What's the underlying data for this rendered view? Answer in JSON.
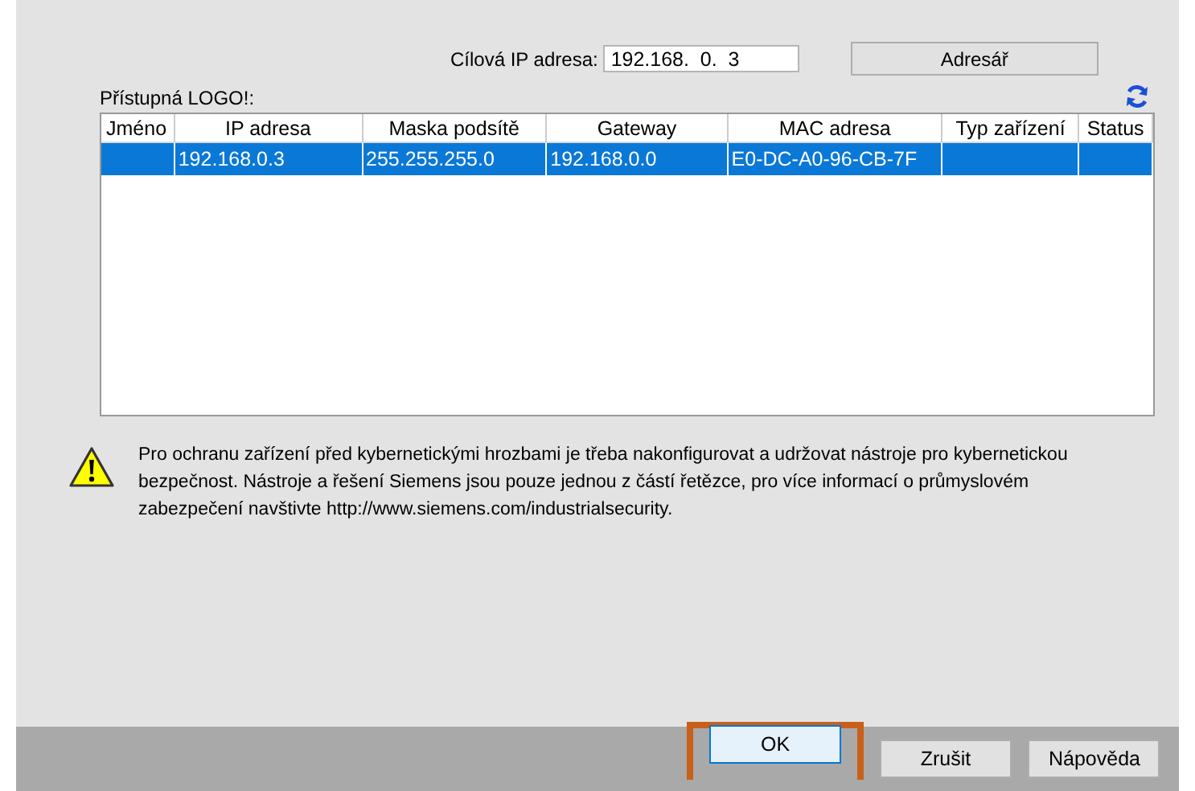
{
  "target_ip": {
    "label": "Cílová IP adresa:",
    "value": "192.168.  0.  3"
  },
  "directory_button": "Adresář",
  "available_label": "Přístupná LOGO!:",
  "table": {
    "columns": [
      "Jméno",
      "IP adresa",
      "Maska podsítě",
      "Gateway",
      "MAC adresa",
      "Typ zařízení",
      "Status"
    ],
    "rows": [
      {
        "selected": true,
        "cells": [
          "",
          "192.168.0.3",
          "255.255.255.0",
          "192.168.0.0",
          "E0-DC-A0-96-CB-7F",
          "",
          ""
        ]
      }
    ]
  },
  "warning": "Pro ochranu zařízení před kybernetickými hrozbami je třeba nakonfigurovat a udržovat nástroje pro kybernetickou bezpečnost. Nástroje a řešení Siemens jsou pouze jednou z částí řetězce, pro více informací o průmyslovém zabezpečení navštivte http://www.siemens.com/industrialsecurity.",
  "buttons": [
    {
      "label": "OK",
      "highlighted": true
    },
    {
      "label": "Zrušit",
      "highlighted": false
    },
    {
      "label": "Nápověda",
      "highlighted": false
    }
  ]
}
